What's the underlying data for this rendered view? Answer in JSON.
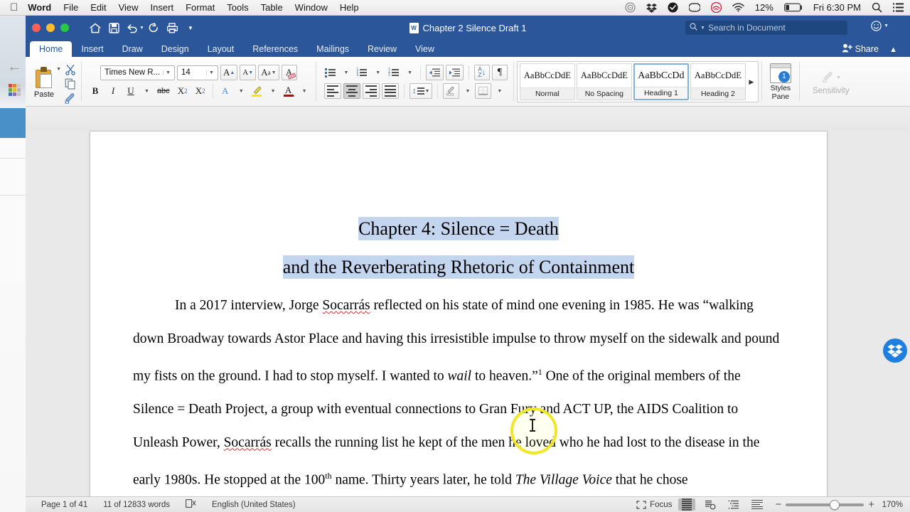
{
  "menubar": {
    "apple_icon": "apple-logo",
    "items": [
      "Word",
      "File",
      "Edit",
      "View",
      "Insert",
      "Format",
      "Tools",
      "Table",
      "Window",
      "Help"
    ],
    "status_icons": [
      "siri-icon",
      "dropbox-icon",
      "checkmark-icon",
      "creative-cloud-icon",
      "backblaze-icon",
      "wifi-icon"
    ],
    "battery_percent": "12%",
    "clock": "Fri 6:30 PM",
    "spotlight_icon": "search-icon",
    "control_center_icon": "list-icon"
  },
  "titlebar": {
    "document_title": "Chapter 2 Silence Draft 1",
    "quick_access": [
      {
        "name": "home-icon",
        "glyph": "⌂"
      },
      {
        "name": "save-icon",
        "glyph": "💾"
      },
      {
        "name": "undo-icon",
        "glyph": "↶"
      },
      {
        "name": "redo-icon",
        "glyph": "↻"
      },
      {
        "name": "print-icon",
        "glyph": "⎙"
      },
      {
        "name": "customize-toolbar-icon",
        "glyph": "▾"
      }
    ],
    "search_placeholder": "Search in Document",
    "share_label": "Share",
    "accent_color": "#2b579a"
  },
  "tabs": [
    {
      "label": "Home",
      "active": true
    },
    {
      "label": "Insert",
      "active": false
    },
    {
      "label": "Draw",
      "active": false
    },
    {
      "label": "Design",
      "active": false
    },
    {
      "label": "Layout",
      "active": false
    },
    {
      "label": "References",
      "active": false
    },
    {
      "label": "Mailings",
      "active": false
    },
    {
      "label": "Review",
      "active": false
    },
    {
      "label": "View",
      "active": false
    }
  ],
  "ribbon": {
    "paste_label": "Paste",
    "font_name": "Times New R...",
    "font_size": "14",
    "font_buttons": [
      {
        "name": "grow-font-button",
        "label": "A▲"
      },
      {
        "name": "shrink-font-button",
        "label": "A▼"
      },
      {
        "name": "change-case-button",
        "label": "Aa"
      },
      {
        "name": "clear-formatting-button",
        "label": "A"
      }
    ],
    "format_buttons": [
      {
        "name": "bold-button",
        "label": "B"
      },
      {
        "name": "italic-button",
        "label": "I"
      },
      {
        "name": "underline-button",
        "label": "U"
      },
      {
        "name": "strikethrough-button",
        "label": "abc"
      },
      {
        "name": "subscript-button",
        "label": "X₂"
      },
      {
        "name": "superscript-button",
        "label": "X²"
      },
      {
        "name": "text-effects-button",
        "label": "A"
      },
      {
        "name": "highlight-color-button",
        "label": "✎"
      },
      {
        "name": "font-color-button",
        "label": "A"
      }
    ],
    "highlight_color": "#ffe400",
    "font_color": "#c00000",
    "align_active": "center",
    "styles": [
      {
        "preview": "AaBbCcDdE",
        "name": "Normal",
        "selected": false
      },
      {
        "preview": "AaBbCcDdE",
        "name": "No Spacing",
        "selected": false
      },
      {
        "preview": "AaBbCcDd",
        "name": "Heading 1",
        "selected": true
      },
      {
        "preview": "AaBbCcDdE",
        "name": "Heading 2",
        "selected": false
      }
    ],
    "styles_pane_label": "Styles Pane",
    "styles_pane_badge": "1",
    "sensitivity_label": "Sensitivity"
  },
  "document": {
    "heading_line1": "Chapter 4: Silence = Death",
    "heading_line2": "and the Reverberating Rhetoric of Containment",
    "selection_color": "#c3d5ef",
    "paragraph": {
      "s1": "In a 2017 interview, Jorge ",
      "misspelled1": "Socarrás",
      "s2": " reflected on his state of mind one evening in 1985. He was “walking down Broadway towards Astor Place and having this irresistible impulse to throw myself on the sidewalk and pound my fists on the ground. I had to stop myself. I wanted to ",
      "italic1": "wail",
      "s3": " to heaven.”",
      "footnote1": "1",
      "s4": " One of the original members of the Silence = Death Project, a group with eventual connections to Gran Fury and ACT UP, the AIDS Coalition to Unleash Power, ",
      "misspelled2": "Socarrás",
      "s5": " recalls the running list he kept of the men he loved who he had lost to the disease in the early 1980s. He stopped at the 100",
      "superscript2": "th",
      "s6": " name. Thirty years later, he told ",
      "italic2": "The Village Voice",
      "s7": " that he chose"
    }
  },
  "statusbar": {
    "page_info": "Page 1 of 41",
    "word_count": "11 of 12833 words",
    "proofing_icon": "proofing-errors-icon",
    "language": "English (United States)",
    "focus_label": "Focus",
    "views": [
      "print-layout-view",
      "web-layout-view",
      "outline-view",
      "draft-view"
    ],
    "active_view": "print-layout-view",
    "zoom_minus": "−",
    "zoom_plus": "+",
    "zoom_level": "170%"
  },
  "overlay": {
    "dropbox_badge_icon": "dropbox-icon",
    "cursor_highlight": "mouse-cursor-highlight"
  }
}
